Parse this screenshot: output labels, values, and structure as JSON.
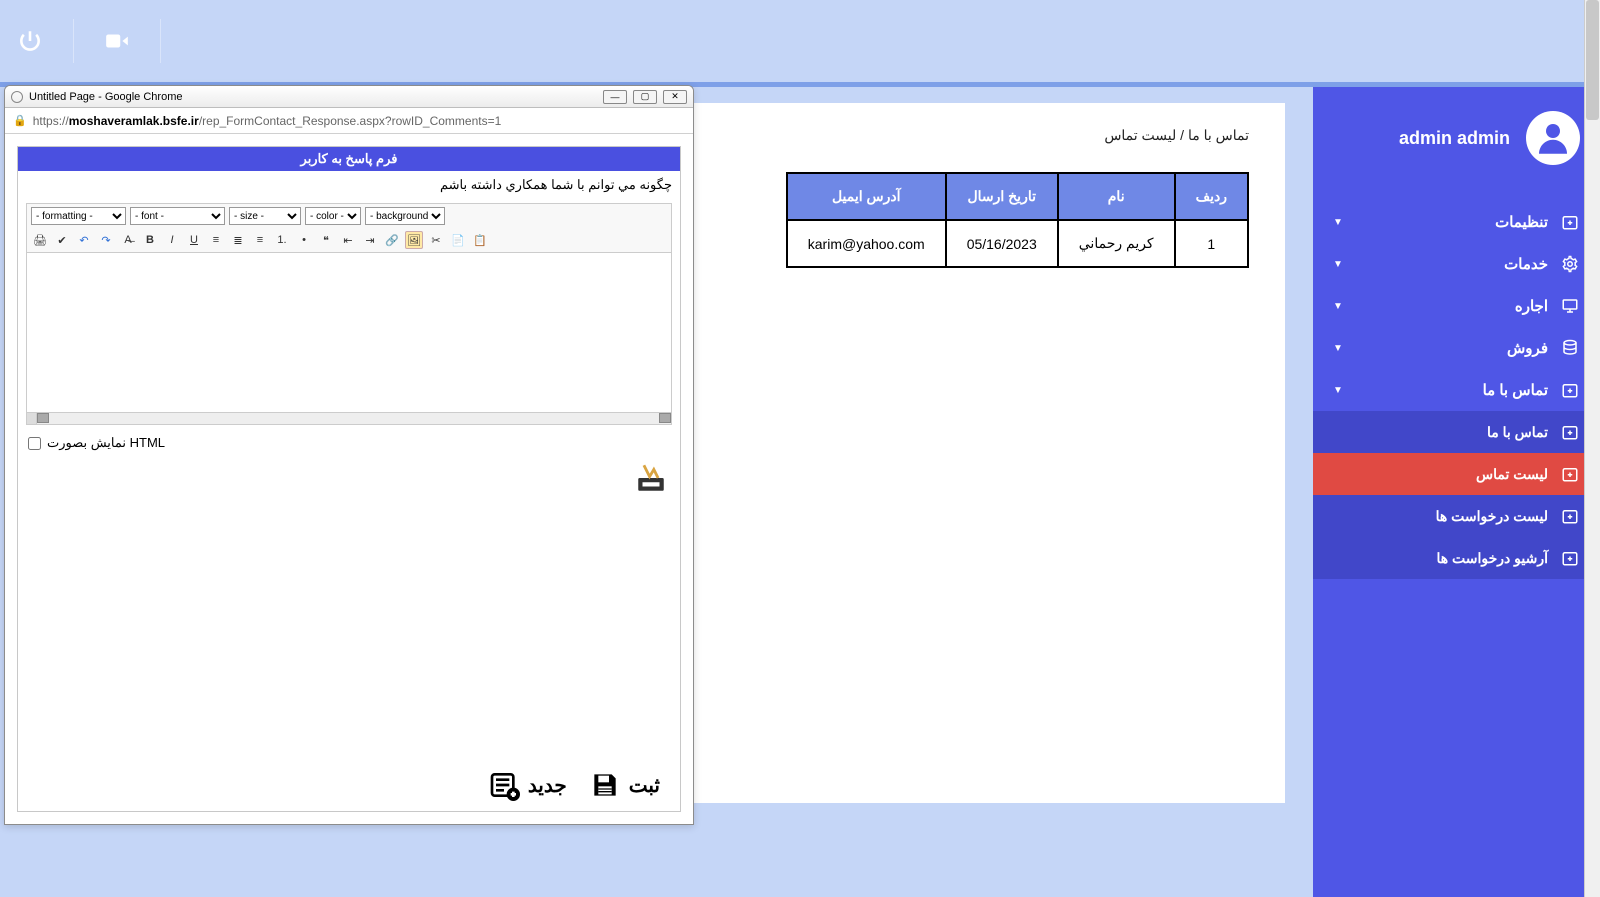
{
  "topbar": {},
  "sidebar": {
    "username": "admin admin",
    "menu": [
      {
        "label": "تنظیمات",
        "icon": "calendar-plus-icon"
      },
      {
        "label": "خدمات",
        "icon": "gear-icon"
      },
      {
        "label": "اجاره",
        "icon": "monitor-icon"
      },
      {
        "label": "فروش",
        "icon": "database-icon"
      },
      {
        "label": "تماس با ما",
        "icon": "calendar-plus-icon"
      }
    ],
    "submenu": [
      {
        "label": "تماس با ما",
        "active": false
      },
      {
        "label": "لیست تماس",
        "active": true
      },
      {
        "label": "لیست درخواست ها",
        "active": false
      },
      {
        "label": "آرشیو درخواست ها",
        "active": false
      }
    ]
  },
  "breadcrumb": "تماس با ما / لیست تماس",
  "table": {
    "headers": [
      "آدرس ایمیل",
      "تاریخ ارسال",
      "نام",
      "ردیف"
    ],
    "rows": [
      {
        "email": "karim@yahoo.com",
        "date": "05/16/2023",
        "name": "كريم رحماني",
        "row": "1"
      }
    ]
  },
  "popup": {
    "window_title": "Untitled Page - Google Chrome",
    "url_host": "moshaveramlak.bsfe.ir",
    "url_scheme": "https://",
    "url_path": "/rep_FormContact_Response.aspx?rowID_Comments=1",
    "header": "فرم پاسخ به كاربر",
    "subject": "چگونه مي توانم با شما همكاري داشته باشم",
    "selects": {
      "formatting": "- formatting -",
      "font": "- font -",
      "size": "- size -",
      "color": "- color -",
      "background": "- background -"
    },
    "html_view_label": "نمایش بصورت HTML",
    "actions": {
      "save": "ثبت",
      "new": "جدید"
    }
  }
}
